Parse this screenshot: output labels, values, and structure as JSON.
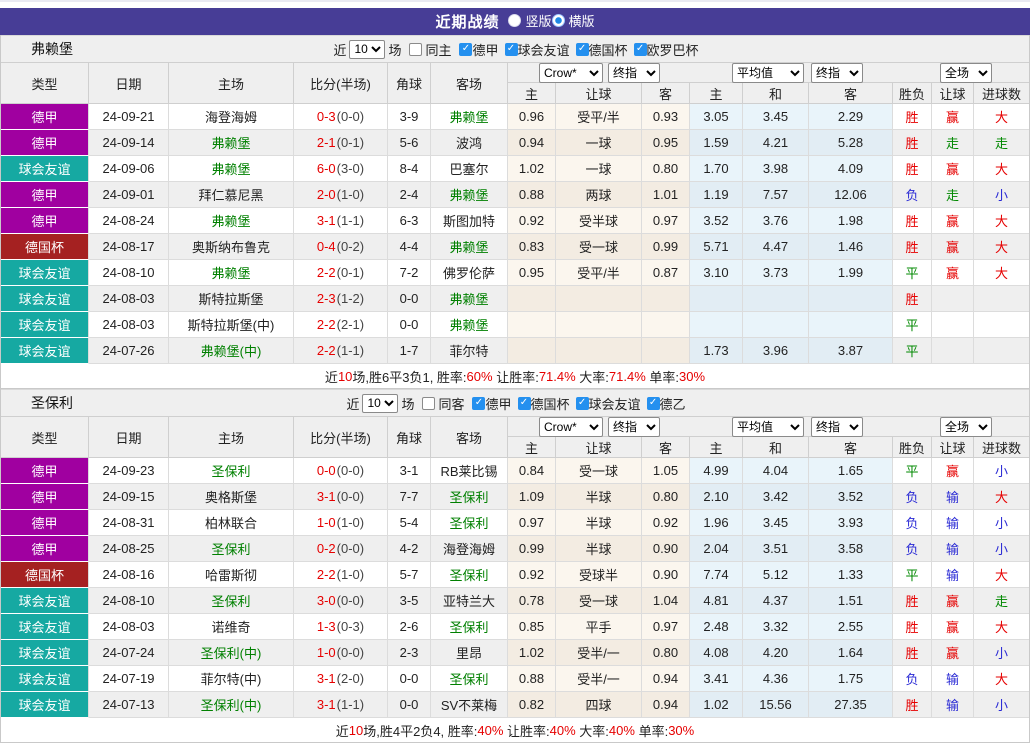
{
  "title_bar": {
    "title": "近期战绩",
    "radios": [
      {
        "label": "竖版",
        "selected": false
      },
      {
        "label": "横版",
        "selected": true
      }
    ]
  },
  "table_header": {
    "left_cols": [
      "类型",
      "日期",
      "主场",
      "比分(半场)",
      "角球",
      "客场"
    ],
    "selects": [
      {
        "name": "crow-odds-source-select",
        "value": "Crow*"
      },
      {
        "name": "crow-odds-stage-select",
        "value": "终指"
      },
      {
        "name": "avg-odds-source-select",
        "value": "平均值"
      },
      {
        "name": "avg-odds-stage-select",
        "value": "终指"
      },
      {
        "name": "scope-select",
        "value": "全场"
      }
    ],
    "sub_cols": [
      "主",
      "让球",
      "客",
      "主",
      "和",
      "客",
      "胜负",
      "让球",
      "进球数"
    ]
  },
  "colors": {
    "title_bar_bg": "#473d96",
    "league": {
      "德甲": "#a000a0",
      "球会友谊": "#16a9a2",
      "德国杯": "#a52121"
    },
    "focus_team": "#008000",
    "score": "#e60000",
    "win": "#e60000",
    "draw": "#008800",
    "loss": "#2b2bd5",
    "checkbox_accent": "#2490ef"
  },
  "sections": [
    {
      "team": "弗赖堡",
      "filter": {
        "near_label": "近",
        "count": "10",
        "unit_label": "场",
        "same_label": "同主",
        "same_checked": false,
        "leagues": [
          {
            "label": "德甲",
            "checked": true
          },
          {
            "label": "球会友谊",
            "checked": true
          },
          {
            "label": "德国杯",
            "checked": true
          },
          {
            "label": "欧罗巴杯",
            "checked": true
          }
        ]
      },
      "rows": [
        {
          "league": "德甲",
          "date": "24-09-21",
          "home": "海登海姆",
          "home_focus": false,
          "score": "0-3",
          "half": "(0-0)",
          "corner": "3-9",
          "away": "弗赖堡",
          "away_focus": true,
          "crow": [
            "0.96",
            "受平/半",
            "0.93"
          ],
          "avg": [
            "3.05",
            "3.45",
            "2.29"
          ],
          "results": [
            [
              "胜",
              "w"
            ],
            [
              "赢",
              "w"
            ],
            [
              "大",
              "w"
            ]
          ]
        },
        {
          "league": "德甲",
          "date": "24-09-14",
          "home": "弗赖堡",
          "home_focus": true,
          "score": "2-1",
          "half": "(0-1)",
          "corner": "5-6",
          "away": "波鸿",
          "away_focus": false,
          "crow": [
            "0.94",
            "一球",
            "0.95"
          ],
          "avg": [
            "1.59",
            "4.21",
            "5.28"
          ],
          "results": [
            [
              "胜",
              "w"
            ],
            [
              "走",
              "d"
            ],
            [
              "走",
              "d"
            ]
          ]
        },
        {
          "league": "球会友谊",
          "date": "24-09-06",
          "home": "弗赖堡",
          "home_focus": true,
          "score": "6-0",
          "half": "(3-0)",
          "corner": "8-4",
          "away": "巴塞尔",
          "away_focus": false,
          "crow": [
            "1.02",
            "一球",
            "0.80"
          ],
          "avg": [
            "1.70",
            "3.98",
            "4.09"
          ],
          "results": [
            [
              "胜",
              "w"
            ],
            [
              "赢",
              "w"
            ],
            [
              "大",
              "w"
            ]
          ]
        },
        {
          "league": "德甲",
          "date": "24-09-01",
          "home": "拜仁慕尼黑",
          "home_focus": false,
          "score": "2-0",
          "half": "(1-0)",
          "corner": "2-4",
          "away": "弗赖堡",
          "away_focus": true,
          "crow": [
            "0.88",
            "两球",
            "1.01"
          ],
          "avg": [
            "1.19",
            "7.57",
            "12.06"
          ],
          "results": [
            [
              "负",
              "l"
            ],
            [
              "走",
              "d"
            ],
            [
              "小",
              "l"
            ]
          ]
        },
        {
          "league": "德甲",
          "date": "24-08-24",
          "home": "弗赖堡",
          "home_focus": true,
          "score": "3-1",
          "half": "(1-1)",
          "corner": "6-3",
          "away": "斯图加特",
          "away_focus": false,
          "crow": [
            "0.92",
            "受半球",
            "0.97"
          ],
          "avg": [
            "3.52",
            "3.76",
            "1.98"
          ],
          "results": [
            [
              "胜",
              "w"
            ],
            [
              "赢",
              "w"
            ],
            [
              "大",
              "w"
            ]
          ]
        },
        {
          "league": "德国杯",
          "date": "24-08-17",
          "home": "奥斯纳布鲁克",
          "home_focus": false,
          "score": "0-4",
          "half": "(0-2)",
          "corner": "4-4",
          "away": "弗赖堡",
          "away_focus": true,
          "crow": [
            "0.83",
            "受一球",
            "0.99"
          ],
          "avg": [
            "5.71",
            "4.47",
            "1.46"
          ],
          "results": [
            [
              "胜",
              "w"
            ],
            [
              "赢",
              "w"
            ],
            [
              "大",
              "w"
            ]
          ]
        },
        {
          "league": "球会友谊",
          "date": "24-08-10",
          "home": "弗赖堡",
          "home_focus": true,
          "score": "2-2",
          "half": "(0-1)",
          "corner": "7-2",
          "away": "佛罗伦萨",
          "away_focus": false,
          "crow": [
            "0.95",
            "受平/半",
            "0.87"
          ],
          "avg": [
            "3.10",
            "3.73",
            "1.99"
          ],
          "results": [
            [
              "平",
              "d"
            ],
            [
              "赢",
              "w"
            ],
            [
              "大",
              "w"
            ]
          ]
        },
        {
          "league": "球会友谊",
          "date": "24-08-03",
          "home": "斯特拉斯堡",
          "home_focus": false,
          "score": "2-3",
          "half": "(1-2)",
          "corner": "0-0",
          "away": "弗赖堡",
          "away_focus": true,
          "crow": [
            "",
            "",
            ""
          ],
          "avg": [
            "",
            "",
            ""
          ],
          "results": [
            [
              "胜",
              "w"
            ],
            [
              "",
              ""
            ],
            [
              "",
              ""
            ]
          ]
        },
        {
          "league": "球会友谊",
          "date": "24-08-03",
          "home": "斯特拉斯堡(中)",
          "home_focus": false,
          "score": "2-2",
          "half": "(2-1)",
          "corner": "0-0",
          "away": "弗赖堡",
          "away_focus": true,
          "crow": [
            "",
            "",
            ""
          ],
          "avg": [
            "",
            "",
            ""
          ],
          "results": [
            [
              "平",
              "d"
            ],
            [
              "",
              ""
            ],
            [
              "",
              ""
            ]
          ]
        },
        {
          "league": "球会友谊",
          "date": "24-07-26",
          "home": "弗赖堡(中)",
          "home_focus": true,
          "score": "2-2",
          "half": "(1-1)",
          "corner": "1-7",
          "away": "菲尔特",
          "away_focus": false,
          "crow": [
            "",
            "",
            ""
          ],
          "avg": [
            "1.73",
            "3.96",
            "3.87"
          ],
          "results": [
            [
              "平",
              "d"
            ],
            [
              "",
              ""
            ],
            [
              "",
              ""
            ]
          ]
        }
      ],
      "summary": [
        [
          "近",
          false
        ],
        [
          "10",
          true
        ],
        [
          "场,胜6平3负1, 胜率:",
          false
        ],
        [
          "60%",
          true
        ],
        [
          " 让胜率:",
          false
        ],
        [
          "71.4%",
          true
        ],
        [
          " 大率:",
          false
        ],
        [
          "71.4%",
          true
        ],
        [
          " 单率:",
          false
        ],
        [
          "30%",
          true
        ]
      ]
    },
    {
      "team": "圣保利",
      "filter": {
        "near_label": "近",
        "count": "10",
        "unit_label": "场",
        "same_label": "同客",
        "same_checked": false,
        "leagues": [
          {
            "label": "德甲",
            "checked": true
          },
          {
            "label": "德国杯",
            "checked": true
          },
          {
            "label": "球会友谊",
            "checked": true
          },
          {
            "label": "德乙",
            "checked": true
          }
        ]
      },
      "rows": [
        {
          "league": "德甲",
          "date": "24-09-23",
          "home": "圣保利",
          "home_focus": true,
          "score": "0-0",
          "half": "(0-0)",
          "corner": "3-1",
          "away": "RB莱比锡",
          "away_focus": false,
          "crow": [
            "0.84",
            "受一球",
            "1.05"
          ],
          "avg": [
            "4.99",
            "4.04",
            "1.65"
          ],
          "results": [
            [
              "平",
              "d"
            ],
            [
              "赢",
              "w"
            ],
            [
              "小",
              "l"
            ]
          ]
        },
        {
          "league": "德甲",
          "date": "24-09-15",
          "home": "奥格斯堡",
          "home_focus": false,
          "score": "3-1",
          "half": "(0-0)",
          "corner": "7-7",
          "away": "圣保利",
          "away_focus": true,
          "crow": [
            "1.09",
            "半球",
            "0.80"
          ],
          "avg": [
            "2.10",
            "3.42",
            "3.52"
          ],
          "results": [
            [
              "负",
              "l"
            ],
            [
              "输",
              "l"
            ],
            [
              "大",
              "w"
            ]
          ]
        },
        {
          "league": "德甲",
          "date": "24-08-31",
          "home": "柏林联合",
          "home_focus": false,
          "score": "1-0",
          "half": "(1-0)",
          "corner": "5-4",
          "away": "圣保利",
          "away_focus": true,
          "crow": [
            "0.97",
            "半球",
            "0.92"
          ],
          "avg": [
            "1.96",
            "3.45",
            "3.93"
          ],
          "results": [
            [
              "负",
              "l"
            ],
            [
              "输",
              "l"
            ],
            [
              "小",
              "l"
            ]
          ]
        },
        {
          "league": "德甲",
          "date": "24-08-25",
          "home": "圣保利",
          "home_focus": true,
          "score": "0-2",
          "half": "(0-0)",
          "corner": "4-2",
          "away": "海登海姆",
          "away_focus": false,
          "crow": [
            "0.99",
            "半球",
            "0.90"
          ],
          "avg": [
            "2.04",
            "3.51",
            "3.58"
          ],
          "results": [
            [
              "负",
              "l"
            ],
            [
              "输",
              "l"
            ],
            [
              "小",
              "l"
            ]
          ]
        },
        {
          "league": "德国杯",
          "date": "24-08-16",
          "home": "哈雷斯彻",
          "home_focus": false,
          "score": "2-2",
          "half": "(1-0)",
          "corner": "5-7",
          "away": "圣保利",
          "away_focus": true,
          "crow": [
            "0.92",
            "受球半",
            "0.90"
          ],
          "avg": [
            "7.74",
            "5.12",
            "1.33"
          ],
          "results": [
            [
              "平",
              "d"
            ],
            [
              "输",
              "l"
            ],
            [
              "大",
              "w"
            ]
          ]
        },
        {
          "league": "球会友谊",
          "date": "24-08-10",
          "home": "圣保利",
          "home_focus": true,
          "score": "3-0",
          "half": "(0-0)",
          "corner": "3-5",
          "away": "亚特兰大",
          "away_focus": false,
          "crow": [
            "0.78",
            "受一球",
            "1.04"
          ],
          "avg": [
            "4.81",
            "4.37",
            "1.51"
          ],
          "results": [
            [
              "胜",
              "w"
            ],
            [
              "赢",
              "w"
            ],
            [
              "走",
              "d"
            ]
          ]
        },
        {
          "league": "球会友谊",
          "date": "24-08-03",
          "home": "诺维奇",
          "home_focus": false,
          "score": "1-3",
          "half": "(0-3)",
          "corner": "2-6",
          "away": "圣保利",
          "away_focus": true,
          "crow": [
            "0.85",
            "平手",
            "0.97"
          ],
          "avg": [
            "2.48",
            "3.32",
            "2.55"
          ],
          "results": [
            [
              "胜",
              "w"
            ],
            [
              "赢",
              "w"
            ],
            [
              "大",
              "w"
            ]
          ]
        },
        {
          "league": "球会友谊",
          "date": "24-07-24",
          "home": "圣保利(中)",
          "home_focus": true,
          "score": "1-0",
          "half": "(0-0)",
          "corner": "2-3",
          "away": "里昂",
          "away_focus": false,
          "crow": [
            "1.02",
            "受半/一",
            "0.80"
          ],
          "avg": [
            "4.08",
            "4.20",
            "1.64"
          ],
          "results": [
            [
              "胜",
              "w"
            ],
            [
              "赢",
              "w"
            ],
            [
              "小",
              "l"
            ]
          ]
        },
        {
          "league": "球会友谊",
          "date": "24-07-19",
          "home": "菲尔特(中)",
          "home_focus": false,
          "score": "3-1",
          "half": "(2-0)",
          "corner": "0-0",
          "away": "圣保利",
          "away_focus": true,
          "crow": [
            "0.88",
            "受半/一",
            "0.94"
          ],
          "avg": [
            "3.41",
            "4.36",
            "1.75"
          ],
          "results": [
            [
              "负",
              "l"
            ],
            [
              "输",
              "l"
            ],
            [
              "大",
              "w"
            ]
          ]
        },
        {
          "league": "球会友谊",
          "date": "24-07-13",
          "home": "圣保利(中)",
          "home_focus": true,
          "score": "3-1",
          "half": "(1-1)",
          "corner": "0-0",
          "away": "SV不莱梅",
          "away_focus": false,
          "crow": [
            "0.82",
            "四球",
            "0.94"
          ],
          "avg": [
            "1.02",
            "15.56",
            "27.35"
          ],
          "results": [
            [
              "胜",
              "w"
            ],
            [
              "输",
              "l"
            ],
            [
              "小",
              "l"
            ]
          ]
        }
      ],
      "summary": [
        [
          "近",
          false
        ],
        [
          "10",
          true
        ],
        [
          "场,胜4平2负4, 胜率:",
          false
        ],
        [
          "40%",
          true
        ],
        [
          " 让胜率:",
          false
        ],
        [
          "40%",
          true
        ],
        [
          " 大率:",
          false
        ],
        [
          "40%",
          true
        ],
        [
          " 单率:",
          false
        ],
        [
          "30%",
          true
        ]
      ]
    }
  ]
}
